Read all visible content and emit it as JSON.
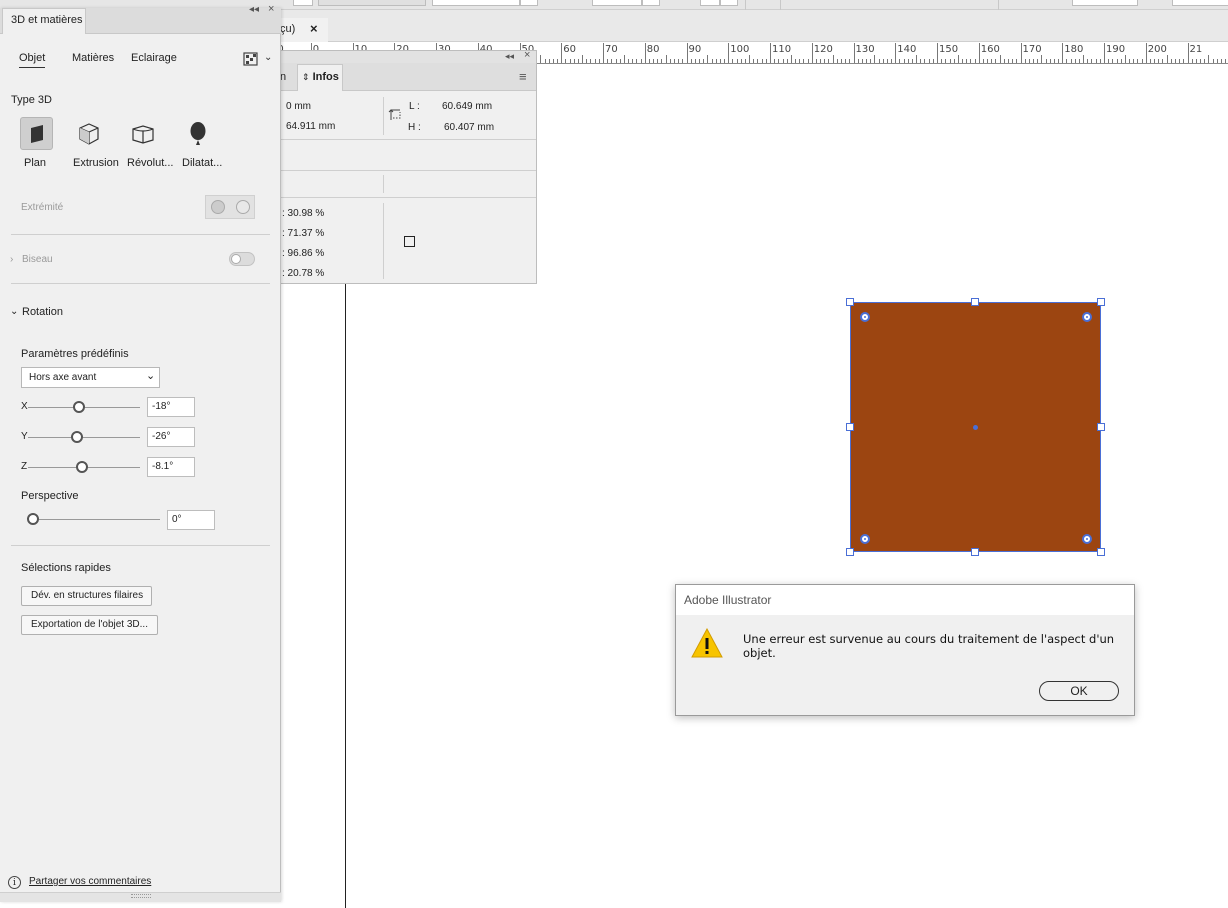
{
  "doc_tab": {
    "title": "çu)",
    "close": "×"
  },
  "ruler": {
    "labels": [
      "10",
      "0",
      "10",
      "20",
      "30",
      "40",
      "50",
      "60",
      "70",
      "80",
      "90",
      "100",
      "110",
      "120",
      "130",
      "140",
      "150",
      "160",
      "170",
      "180",
      "190",
      "200",
      "21"
    ]
  },
  "panel": {
    "title": "3D et matières",
    "tabs": [
      "Objet",
      "Matières",
      "Eclairage"
    ],
    "type3d": {
      "label": "Type 3D",
      "options": [
        "Plan",
        "Extrusion",
        "Révolut...",
        "Dilatat..."
      ],
      "selected": "Plan"
    },
    "extremite": "Extrémité",
    "biseau": "Biseau",
    "rotation": {
      "label": "Rotation",
      "presets_label": "Paramètres prédéfinis",
      "preset_value": "Hors axe avant",
      "x_label": "X",
      "x_value": "-18°",
      "y_label": "Y",
      "y_value": "-26°",
      "z_label": "Z",
      "z_value": "-8.1°",
      "perspective_label": "Perspective",
      "perspective_value": "0°"
    },
    "quick": {
      "label": "Sélections rapides",
      "wireframe_btn": "Dév. en structures filaires",
      "export_btn": "Exportation de l'objet 3D..."
    },
    "feedback": "Partager vos commentaires"
  },
  "infos": {
    "tab_partial": "n",
    "tab": "Infos",
    "x_val": "0 mm",
    "y_val": "64.911 mm",
    "w_label": "L :",
    "w_val": "60.649 mm",
    "h_label": "H :",
    "h_val": "60.407 mm",
    "c_val": ": 30.98 %",
    "m_val": ": 71.37 %",
    "j_val": ": 96.86 %",
    "k_val": ": 20.78 %"
  },
  "artwork": {
    "fill": "#9c4511",
    "selection": "#4a6fd6"
  },
  "dialog": {
    "title": "Adobe Illustrator",
    "message": "Une erreur est survenue au cours du traitement de l'aspect d'un objet.",
    "ok": "OK"
  }
}
